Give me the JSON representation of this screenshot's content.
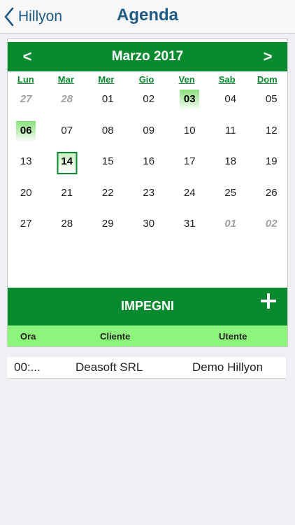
{
  "nav": {
    "back_label": "Hillyon",
    "title": "Agenda"
  },
  "calendar": {
    "month_label": "Marzo 2017",
    "prev_glyph": "<",
    "next_glyph": ">",
    "weekdays": [
      "Lun",
      "Mar",
      "Mer",
      "Gio",
      "Ven",
      "Sab",
      "Dom"
    ],
    "weeks": [
      [
        {
          "d": "27",
          "other": true
        },
        {
          "d": "28",
          "other": true
        },
        {
          "d": "01"
        },
        {
          "d": "02"
        },
        {
          "d": "03",
          "event": true
        },
        {
          "d": "04"
        },
        {
          "d": "05"
        }
      ],
      [
        {
          "d": "06",
          "event": true
        },
        {
          "d": "07"
        },
        {
          "d": "08"
        },
        {
          "d": "09"
        },
        {
          "d": "10"
        },
        {
          "d": "11"
        },
        {
          "d": "12"
        }
      ],
      [
        {
          "d": "13"
        },
        {
          "d": "14",
          "today": true
        },
        {
          "d": "15"
        },
        {
          "d": "16"
        },
        {
          "d": "17"
        },
        {
          "d": "18"
        },
        {
          "d": "19"
        }
      ],
      [
        {
          "d": "20"
        },
        {
          "d": "21"
        },
        {
          "d": "22"
        },
        {
          "d": "23"
        },
        {
          "d": "24"
        },
        {
          "d": "25"
        },
        {
          "d": "26"
        }
      ],
      [
        {
          "d": "27"
        },
        {
          "d": "28"
        },
        {
          "d": "29"
        },
        {
          "d": "30"
        },
        {
          "d": "31"
        },
        {
          "d": "01",
          "other": true
        },
        {
          "d": "02",
          "other": true
        }
      ]
    ]
  },
  "impegni": {
    "title": "IMPEGNI",
    "columns": {
      "ora": "Ora",
      "cliente": "Cliente",
      "utente": "Utente"
    },
    "rows": [
      {
        "ora": "00:...",
        "cliente": "Deasoft SRL",
        "utente": "Demo Hillyon"
      }
    ]
  },
  "colors": {
    "accent_green": "#0a8a2e",
    "header_light_green": "#8ef57c",
    "nav_blue": "#1d5a86",
    "background": "#efeff4"
  },
  "icons": {
    "back": "chevron-left-icon",
    "add": "plus-icon"
  }
}
